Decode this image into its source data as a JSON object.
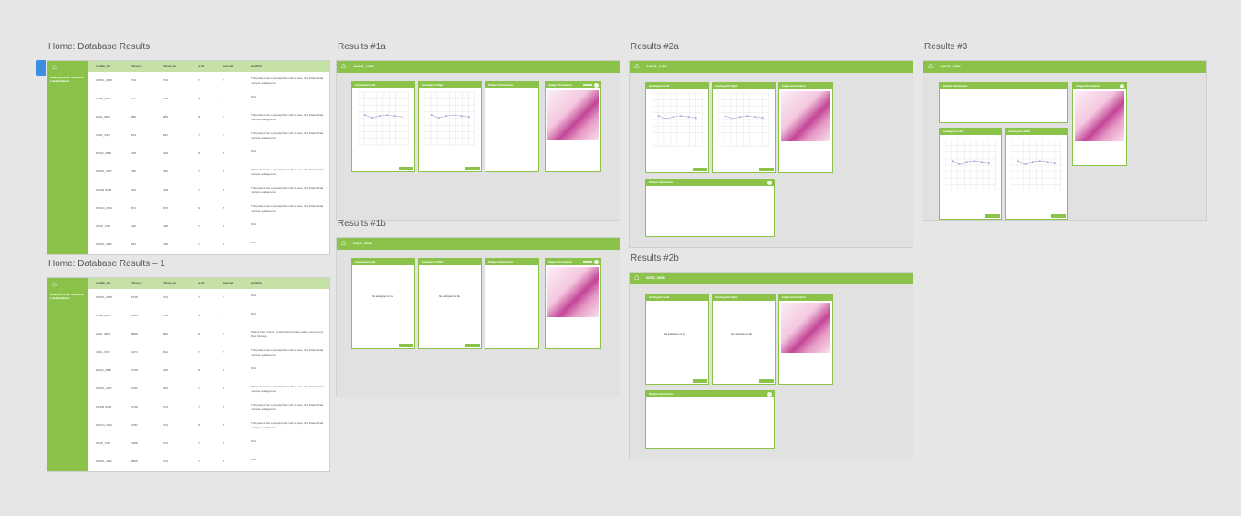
{
  "frames": {
    "home": {
      "title": "Home: Database Results"
    },
    "home1": {
      "title": "Home: Database Results – 1"
    },
    "r1a": {
      "title": "Results #1a",
      "pid": "AHCK_1486"
    },
    "r1b": {
      "title": "Results #1b",
      "pid": "ISGD_0896"
    },
    "r2a": {
      "title": "Results #2a",
      "pid": "AHCK_1486"
    },
    "r2b": {
      "title": "Results #2b",
      "pid": "ISGD_0896"
    },
    "r3": {
      "title": "Results #3",
      "pid": "AHCK_1486"
    }
  },
  "table": {
    "headers": [
      "USER_ID",
      "TRAV_L",
      "TRAV_R",
      "AGT",
      "IMAGE",
      "NOTES"
    ],
    "sidebar_title": "Dean Eye & Ear Temporal Lobe Database",
    "rows": [
      {
        "id": "WWDL_4588",
        "l": "704",
        "r": "702",
        "a": "Y",
        "i": "Y",
        "n": "This patient has a Agoraphobe with a case, tba. Patient had multiple audiograms."
      },
      {
        "id": "PKGL_2849",
        "l": "707",
        "r": "708",
        "a": "N",
        "i": "Y",
        "n": "N/A"
      },
      {
        "id": "HGIE_4809",
        "l": "880",
        "r": "884",
        "a": "N",
        "i": "Y",
        "n": "This patient has a Agoraphobe with a case, tba. Patient had multiple audiograms."
      },
      {
        "id": "CKDL_8374",
        "l": "844",
        "r": "842",
        "a": "Y",
        "i": "Y",
        "n": "This patient has a Agoraphobe with a case, tba. Patient had multiple audiograms."
      },
      {
        "id": "DPQS_2884",
        "l": "338",
        "r": "339",
        "a": "N",
        "i": "N",
        "n": "N/A"
      },
      {
        "id": "WWDL_2007",
        "l": "486",
        "r": "484",
        "a": "Y",
        "i": "N",
        "n": "This patient has a Agoraphobe with a case, tba. Patient had multiple audiograms."
      },
      {
        "id": "PWKB_8283",
        "l": "400",
        "r": "408",
        "a": "Y",
        "i": "N",
        "n": "This patient has a Agoraphobe with a case, tba. Patient had multiple audiograms."
      },
      {
        "id": "WWLD_2849",
        "l": "874",
        "r": "870",
        "a": "N",
        "i": "N",
        "n": "This patient has a Agoraphobe with a case, tba. Patient had multiple audiograms."
      },
      {
        "id": "WIGP_7284",
        "l": "420",
        "r": "428",
        "a": "Y",
        "i": "N",
        "n": "N/A"
      },
      {
        "id": "WWDL_4882",
        "l": "840",
        "r": "448",
        "a": "Y",
        "i": "N",
        "n": "N/A"
      }
    ],
    "rows1": [
      {
        "id": "WWDL_4588",
        "l": "5728",
        "r": "702",
        "a": "Y",
        "i": "Y",
        "n": "N/A"
      },
      {
        "id": "PKGL_2849",
        "l": "8408",
        "r": "708",
        "a": "N",
        "i": "Y",
        "n": "N/A"
      },
      {
        "id": "HGIE_4809",
        "l": "8888",
        "r": "884",
        "a": "N",
        "i": "Y",
        "n": "Patient has tinnitus. Cochlear information taken via Auditory Data Storage."
      },
      {
        "id": "CKDL_8374",
        "l": "4473",
        "r": "842",
        "a": "Y",
        "i": "Y",
        "n": "This patient has a Agoraphobe with a case, tba. Patient had multiple audiograms."
      },
      {
        "id": "DPQS_2884",
        "l": "2738",
        "r": "339",
        "a": "N",
        "i": "N",
        "n": "N/A"
      },
      {
        "id": "WWDL_2007",
        "l": "4780",
        "r": "484",
        "a": "Y",
        "i": "N",
        "n": "This patient has a Agoraphobe with a case, tba. Patient had multiple audiograms."
      },
      {
        "id": "PWKB_8283",
        "l": "3748",
        "r": "702",
        "a": "Y",
        "i": "N",
        "n": "This patient has a Agoraphobe with a case, tba. Patient had multiple audiograms."
      },
      {
        "id": "WWLD_2849",
        "l": "4784",
        "r": "702",
        "a": "N",
        "i": "N",
        "n": "This patient has a Agoraphobe with a case, tba. Patient had multiple audiograms."
      },
      {
        "id": "WIGP_7284",
        "l": "4288",
        "r": "702",
        "a": "Y",
        "i": "N",
        "n": "N/A"
      },
      {
        "id": "WWDL_4882",
        "l": "8808",
        "r": "702",
        "a": "Y",
        "i": "N",
        "n": "N/A"
      }
    ]
  },
  "cards": {
    "aud_left": "Audiogram Left",
    "aud_right": "Audiogram Right",
    "patient_info": "Patient Information",
    "image_info": "Image Information",
    "no_audiogram": "No audiogram on file"
  },
  "colors": {
    "accent": "#8bc34a",
    "header_light": "#c5e1a5",
    "tab_blue": "#3b8fe0"
  }
}
